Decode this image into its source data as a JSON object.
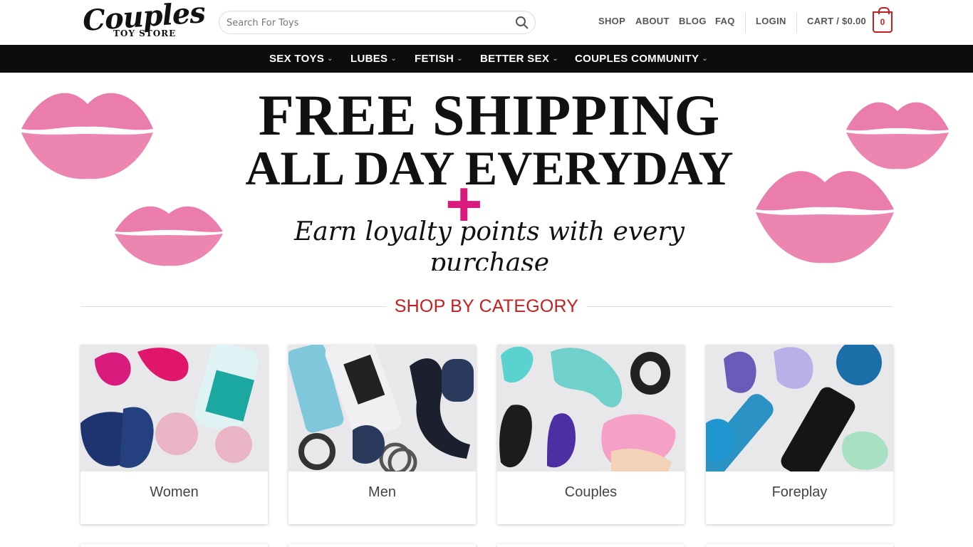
{
  "logo": {
    "script_text": "Couples",
    "sub_text": "TOY STORE"
  },
  "search": {
    "placeholder": "Search For Toys"
  },
  "topnav": {
    "shop": "SHOP",
    "about": "ABOUT",
    "blog": "BLOG",
    "faq": "FAQ",
    "login": "LOGIN",
    "cart": "CART / $0.00",
    "cart_count": "0"
  },
  "mainnav": [
    {
      "label": "SEX TOYS"
    },
    {
      "label": "LUBES"
    },
    {
      "label": "FETISH"
    },
    {
      "label": "BETTER SEX"
    },
    {
      "label": "COUPLES COMMUNITY"
    }
  ],
  "banner": {
    "line1": "FREE SHIPPING",
    "line2": "ALL DAY EVERYDAY",
    "plus": "+",
    "line3": "Earn loyalty points with every purchase"
  },
  "section_title": "SHOP BY CATEGORY",
  "categories": [
    {
      "label": "Women"
    },
    {
      "label": "Men"
    },
    {
      "label": "Couples"
    },
    {
      "label": "Foreplay"
    }
  ],
  "colors": {
    "accent": "#c81e1e",
    "nav_bg": "#0c0c0c",
    "plus": "#d81b7d",
    "lips": "#e8669e"
  }
}
